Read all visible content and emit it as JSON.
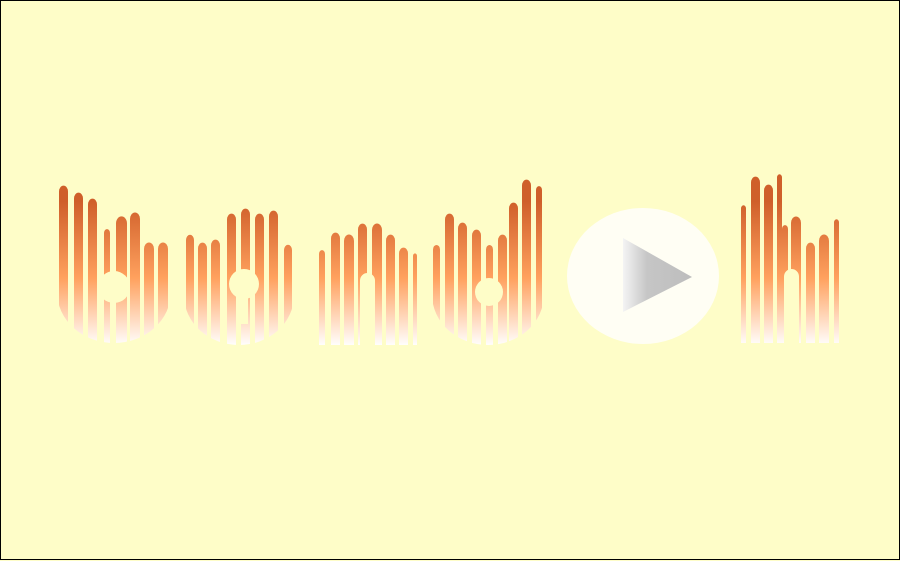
{
  "logo": {
    "text": "bandoh",
    "colors": {
      "background": "#fefdc8",
      "bar_top": "#cf5f2a",
      "bar_mid": "#ffa15e",
      "bar_bottom": "#ffffff",
      "play_circle": "#fffef4",
      "play_triangle": "#bdbdbd"
    }
  }
}
